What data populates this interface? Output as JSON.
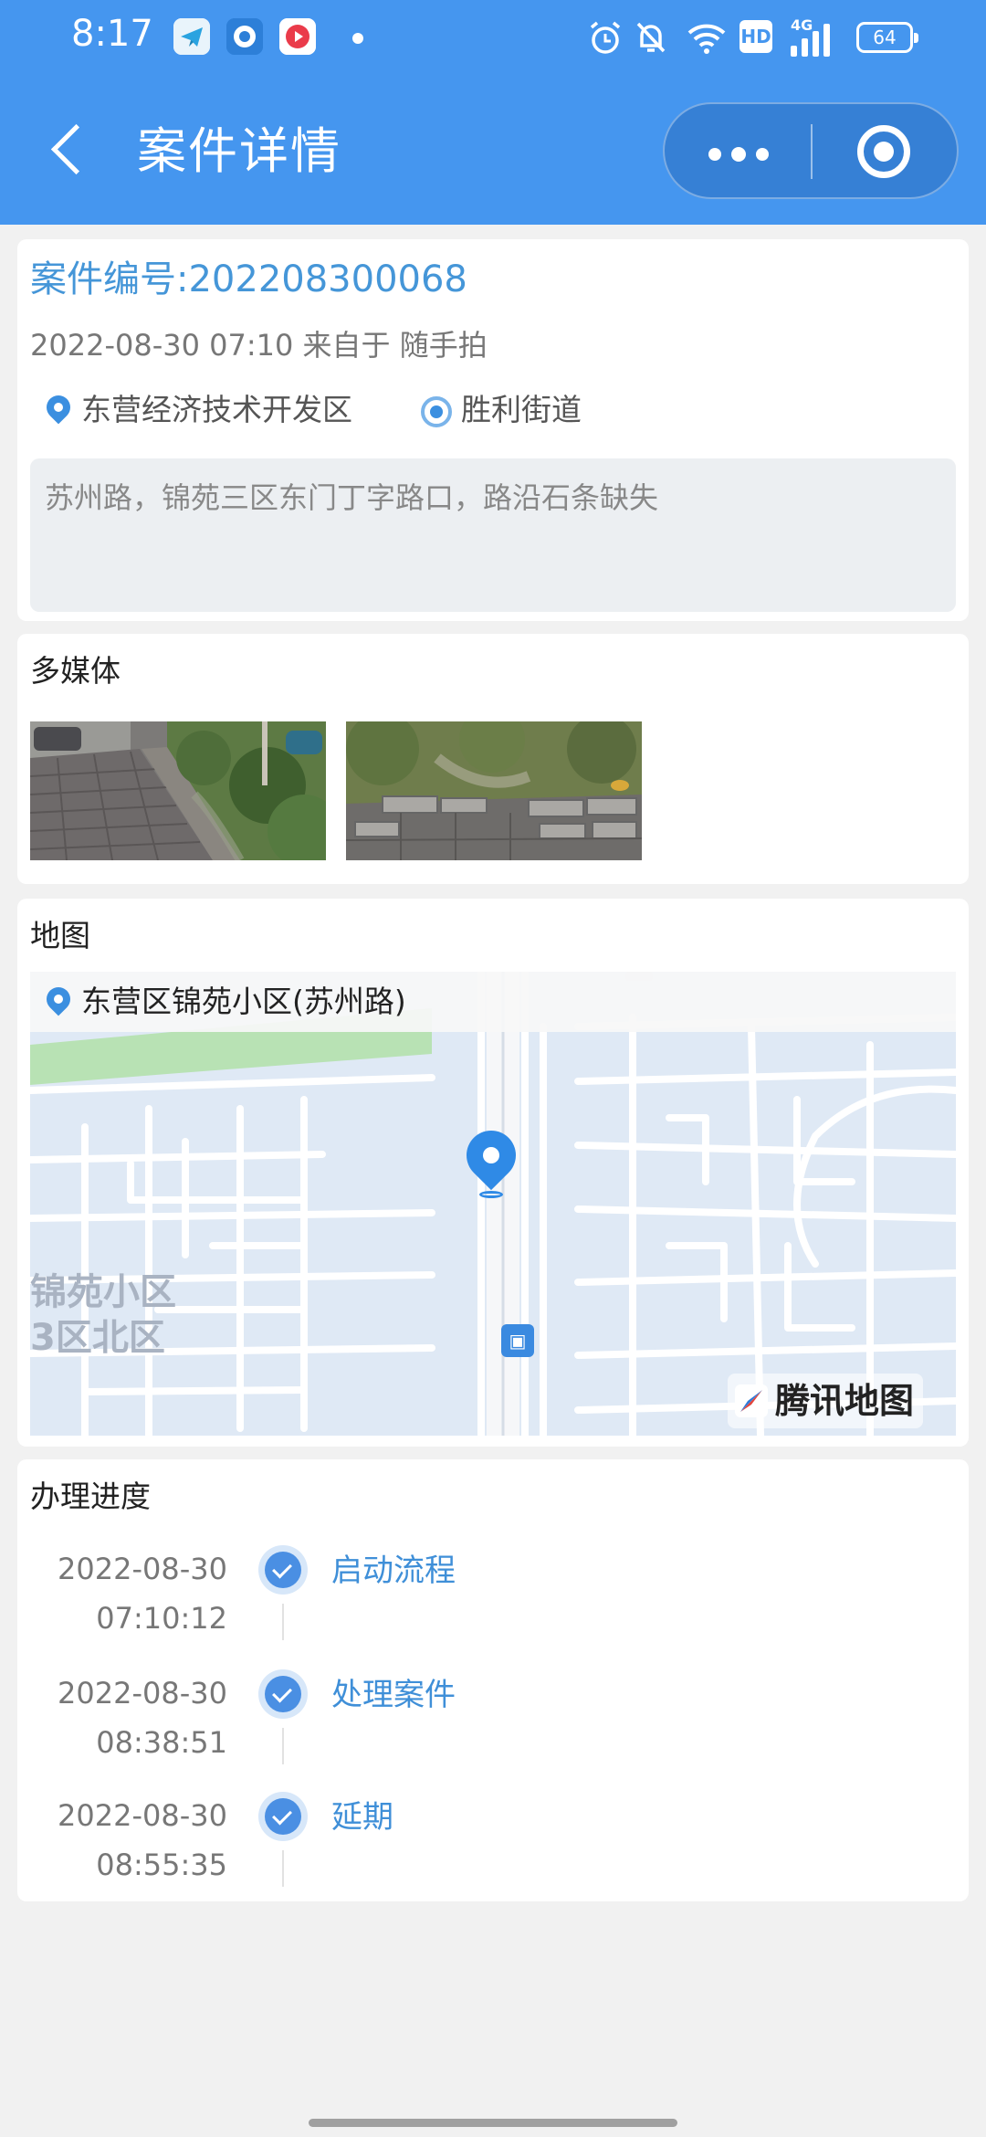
{
  "status_bar": {
    "time": "8:17",
    "battery": "64",
    "network": "4G",
    "hd": "HD",
    "icons": [
      "telegram-app-icon",
      "browser-app-icon",
      "video-app-icon",
      "alarm-icon",
      "mute-icon",
      "wifi-icon",
      "hd-icon",
      "signal-icon",
      "battery-icon"
    ]
  },
  "header": {
    "title": "案件详情",
    "back_icon": "chevron-left-icon",
    "more_icon": "more-dots-icon",
    "close_icon": "target-circle-icon",
    "color": "#4596ef"
  },
  "case": {
    "number": "案件编号:202208300068",
    "meta": "2022-08-30 07:10 来自于 随手拍",
    "district": "东营经济技术开发区",
    "street": "胜利街道",
    "description": "苏州路，锦苑三区东门丁字路口，路沿石条缺失"
  },
  "media": {
    "title": "多媒体",
    "photos": [
      "sidewalk-photo",
      "broken-curb-photo"
    ]
  },
  "map": {
    "title": "地图",
    "address": "东营区锦苑小区(苏州路)",
    "area_label_1": "锦苑小区",
    "area_label_2": "3区北区",
    "logo": "腾讯地图",
    "bus_icon": "bus-stop-icon"
  },
  "progress": {
    "title": "办理进度",
    "steps": [
      {
        "date": "2022-08-30",
        "time": "07:10:12",
        "label": "启动流程"
      },
      {
        "date": "2022-08-30",
        "time": "08:38:51",
        "label": "处理案件"
      },
      {
        "date": "2022-08-30",
        "time": "08:55:35",
        "label": "延期"
      }
    ],
    "accent": "#3f8fd8"
  }
}
